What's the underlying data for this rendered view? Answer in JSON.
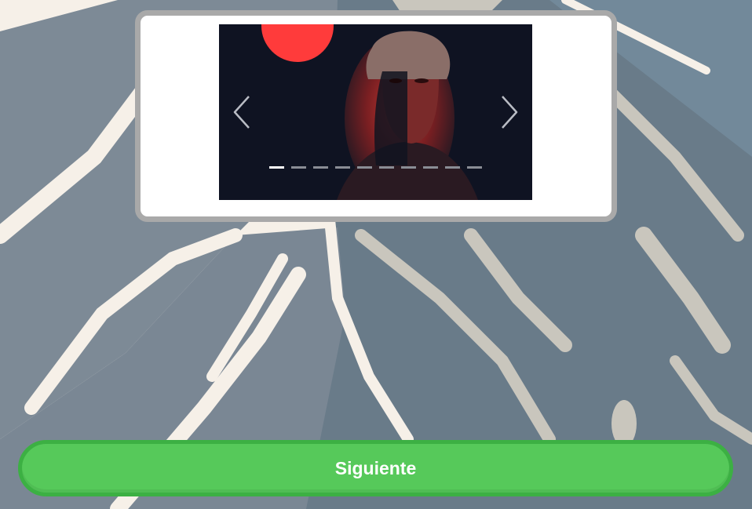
{
  "carousel": {
    "total_slides": 10,
    "active_slide": 1,
    "prev_icon": "chevron-left-icon",
    "next_icon": "chevron-right-icon"
  },
  "footer": {
    "next_label": "Siguiente",
    "button_color": "#56c95a",
    "button_border_color": "#3cb043"
  },
  "colors": {
    "background_light": "#f7f1ea",
    "background_dark": "#6b7c8a",
    "card_border": "#a9a9a9",
    "accent_red": "#ff3b3b"
  }
}
